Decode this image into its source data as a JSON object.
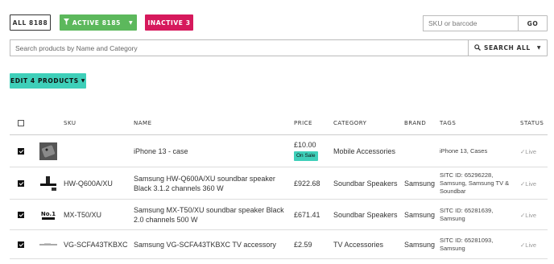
{
  "filters": {
    "all_label": "ALL 8188",
    "active_label": "ACTIVE 8185",
    "inactive_label": "INACTIVE 3"
  },
  "sku_search": {
    "placeholder": "SKU or barcode",
    "value": "",
    "go_label": "GO"
  },
  "product_search": {
    "placeholder": "Search products by Name and Category",
    "value": "",
    "scope_label": "SEARCH ALL"
  },
  "bulk": {
    "edit_label": "EDIT 4 PRODUCTS"
  },
  "table": {
    "headers": {
      "sku": "SKU",
      "name": "NAME",
      "price": "PRICE",
      "category": "CATEGORY",
      "brand": "BRAND",
      "tags": "TAGS",
      "status": "STATUS"
    },
    "rows": [
      {
        "checked": true,
        "thumb": "phone-case-thumb",
        "sku": "",
        "name": "iPhone 13 - case",
        "price": "£10.00",
        "badge": "On Sale",
        "category": "Mobile Accessories",
        "brand": "",
        "tags": "iPhone 13, Cases",
        "status": "Live"
      },
      {
        "checked": true,
        "thumb": "soundbar-thumb",
        "sku": "HW-Q600A/XU",
        "name": "Samsung HW-Q600A/XU soundbar speaker Black 3.1.2 channels 360 W",
        "price": "£922.68",
        "badge": "",
        "category": "Soundbar Speakers",
        "brand": "Samsung",
        "tags": "SITC ID: 65296228, Samsung, Samsung TV & Soundbar",
        "status": "Live"
      },
      {
        "checked": true,
        "thumb": "no1-soundbar-thumb",
        "sku": "MX-T50/XU",
        "name": "Samsung MX-T50/XU soundbar speaker Black 2.0 channels 500 W",
        "price": "£671.41",
        "badge": "",
        "category": "Soundbar Speakers",
        "brand": "Samsung",
        "tags": "SITC ID: 65281639, Samsung",
        "status": "Live"
      },
      {
        "checked": true,
        "thumb": "tv-accessory-thumb",
        "sku": "VG-SCFA43TKBXC",
        "name": "Samsung VG-SCFA43TKBXC TV accessory",
        "price": "£2.59",
        "badge": "",
        "category": "TV Accessories",
        "brand": "Samsung",
        "tags": "SITC ID: 65281093, Samsung",
        "status": "Live"
      }
    ]
  },
  "colors": {
    "active": "#5cb85c",
    "inactive": "#d6195c",
    "accent": "#3ecfb9"
  }
}
